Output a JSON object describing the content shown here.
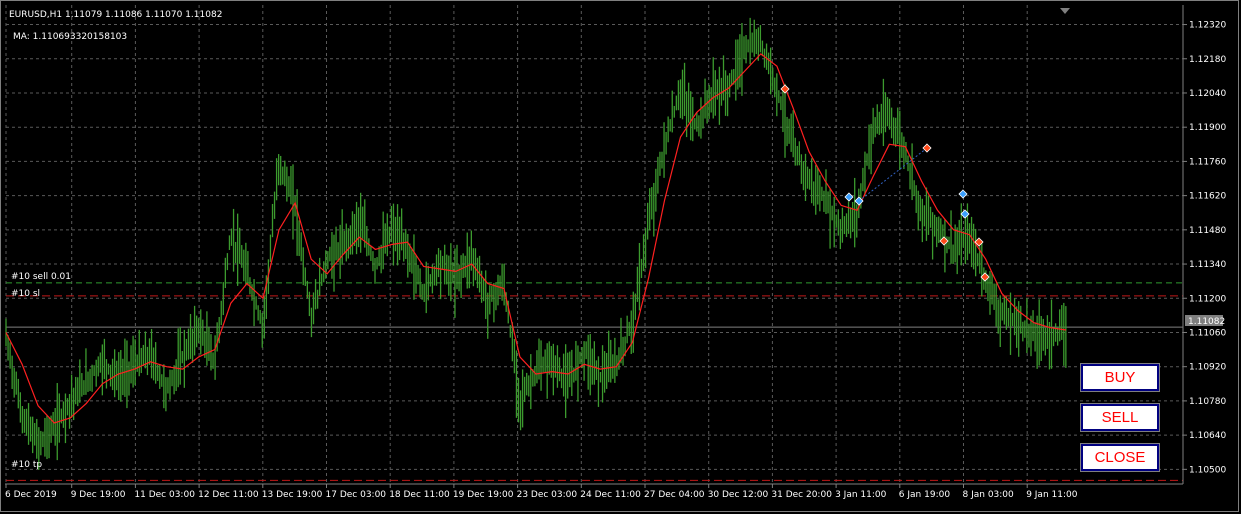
{
  "header": {
    "ohlc_line": "EURUSD,H1  1.11079 1.11086 1.11070 1.11082",
    "indicator_line": "MA: 1.110693320158103"
  },
  "order_lines": {
    "sell": "#10 sell 0.01",
    "sl": "#10 sl",
    "tp": "#10 tp"
  },
  "current_price_label": "1.11082",
  "buttons": {
    "buy": "BUY",
    "sell": "SELL",
    "close": "CLOSE"
  },
  "colors": {
    "background": "#000000",
    "grid": "#5a5a5a",
    "candles": "#3c9b2e",
    "ma_line": "#ff2020",
    "order_line": "#2f9a2f",
    "stop_line": "#c01818",
    "button_text": "#ff0000",
    "button_border": "#000080"
  },
  "chart_data": {
    "type": "line",
    "symbol": "EURUSD",
    "timeframe": "H1",
    "y_ticks": [
      "1.12320",
      "1.12180",
      "1.12040",
      "1.11900",
      "1.11760",
      "1.11620",
      "1.11480",
      "1.11340",
      "1.11200",
      "1.11060",
      "1.10920",
      "1.10780",
      "1.10640",
      "1.10500"
    ],
    "x_ticks": [
      "6 Dec 2019",
      "9 Dec 19:00",
      "11 Dec 03:00",
      "12 Dec 11:00",
      "13 Dec 19:00",
      "17 Dec 03:00",
      "18 Dec 11:00",
      "19 Dec 19:00",
      "23 Dec 03:00",
      "24 Dec 11:00",
      "27 Dec 04:00",
      "30 Dec 12:00",
      "31 Dec 20:00",
      "3 Jan 11:00",
      "6 Jan 19:00",
      "8 Jan 03:00",
      "9 Jan 11:00"
    ],
    "ylim": [
      1.1044,
      1.124
    ],
    "series": [
      {
        "name": "EURUSD",
        "values": [
          1.1104,
          1.1072,
          1.106,
          1.1067,
          1.1078,
          1.1086,
          1.1094,
          1.1087,
          1.1093,
          1.1097,
          1.1082,
          1.1096,
          1.1108,
          1.1094,
          1.1146,
          1.113,
          1.1108,
          1.1176,
          1.1158,
          1.1112,
          1.1136,
          1.1141,
          1.1152,
          1.1133,
          1.1148,
          1.114,
          1.1122,
          1.1135,
          1.1128,
          1.1138,
          1.1118,
          1.1126,
          1.1078,
          1.109,
          1.1094,
          1.1085,
          1.1099,
          1.1088,
          1.1093,
          1.111,
          1.115,
          1.1182,
          1.1205,
          1.119,
          1.1204,
          1.1206,
          1.1222,
          1.1225,
          1.1206,
          1.1182,
          1.1168,
          1.116,
          1.1148,
          1.1155,
          1.119,
          1.1195,
          1.118,
          1.1155,
          1.1149,
          1.114,
          1.1145,
          1.1128,
          1.1113,
          1.111,
          1.1105,
          1.1105,
          1.1106
        ]
      },
      {
        "name": "MA",
        "values": [
          1.1106,
          1.1093,
          1.1076,
          1.1069,
          1.1071,
          1.1077,
          1.1085,
          1.1089,
          1.1091,
          1.1094,
          1.1092,
          1.1091,
          1.1096,
          1.1099,
          1.1118,
          1.1126,
          1.112,
          1.1148,
          1.1159,
          1.1136,
          1.113,
          1.1138,
          1.1145,
          1.114,
          1.1142,
          1.1143,
          1.1133,
          1.1132,
          1.1131,
          1.1134,
          1.1126,
          1.1124,
          1.1096,
          1.1089,
          1.109,
          1.1089,
          1.1093,
          1.1091,
          1.1092,
          1.1102,
          1.1128,
          1.116,
          1.1186,
          1.1196,
          1.1202,
          1.1206,
          1.1213,
          1.122,
          1.1215,
          1.1198,
          1.118,
          1.1168,
          1.1158,
          1.1156,
          1.117,
          1.1183,
          1.1182,
          1.1168,
          1.1156,
          1.1148,
          1.1146,
          1.1136,
          1.1122,
          1.1115,
          1.111,
          1.1108,
          1.1107
        ]
      }
    ],
    "levels": {
      "sell": 1.11263,
      "sl": 1.1121,
      "tp": 1.10455,
      "current": 1.11082
    },
    "grid": true
  }
}
